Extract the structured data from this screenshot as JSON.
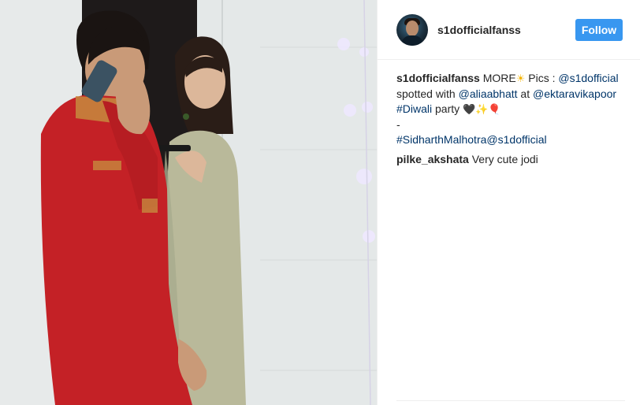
{
  "post": {
    "username": "s1dofficialfanss",
    "follow_label": "Follow",
    "accent_color": "#3897f0",
    "avatar_icon": "profile-avatar"
  },
  "caption": {
    "user": "s1dofficialfanss",
    "t1": "MORE",
    "sun_emoji": "☀",
    "t2": " Pics : ",
    "mention_1": "@s1dofficial",
    "t3": "spotted with ",
    "mention_2": "@aliaabhatt",
    "t4": " at ",
    "mention_3": "@ektaravikapoor",
    "hashtag_1": "#Diwali",
    "t5": " party ",
    "emojis": [
      "🖤",
      "✨",
      "🎈"
    ],
    "dash": "-",
    "hashtag_2": "#SidharthMalhotra",
    "mention_4": "@s1dofficial"
  },
  "comments": [
    {
      "user": "pilke_akshata",
      "text": "Very cute jodi"
    }
  ]
}
